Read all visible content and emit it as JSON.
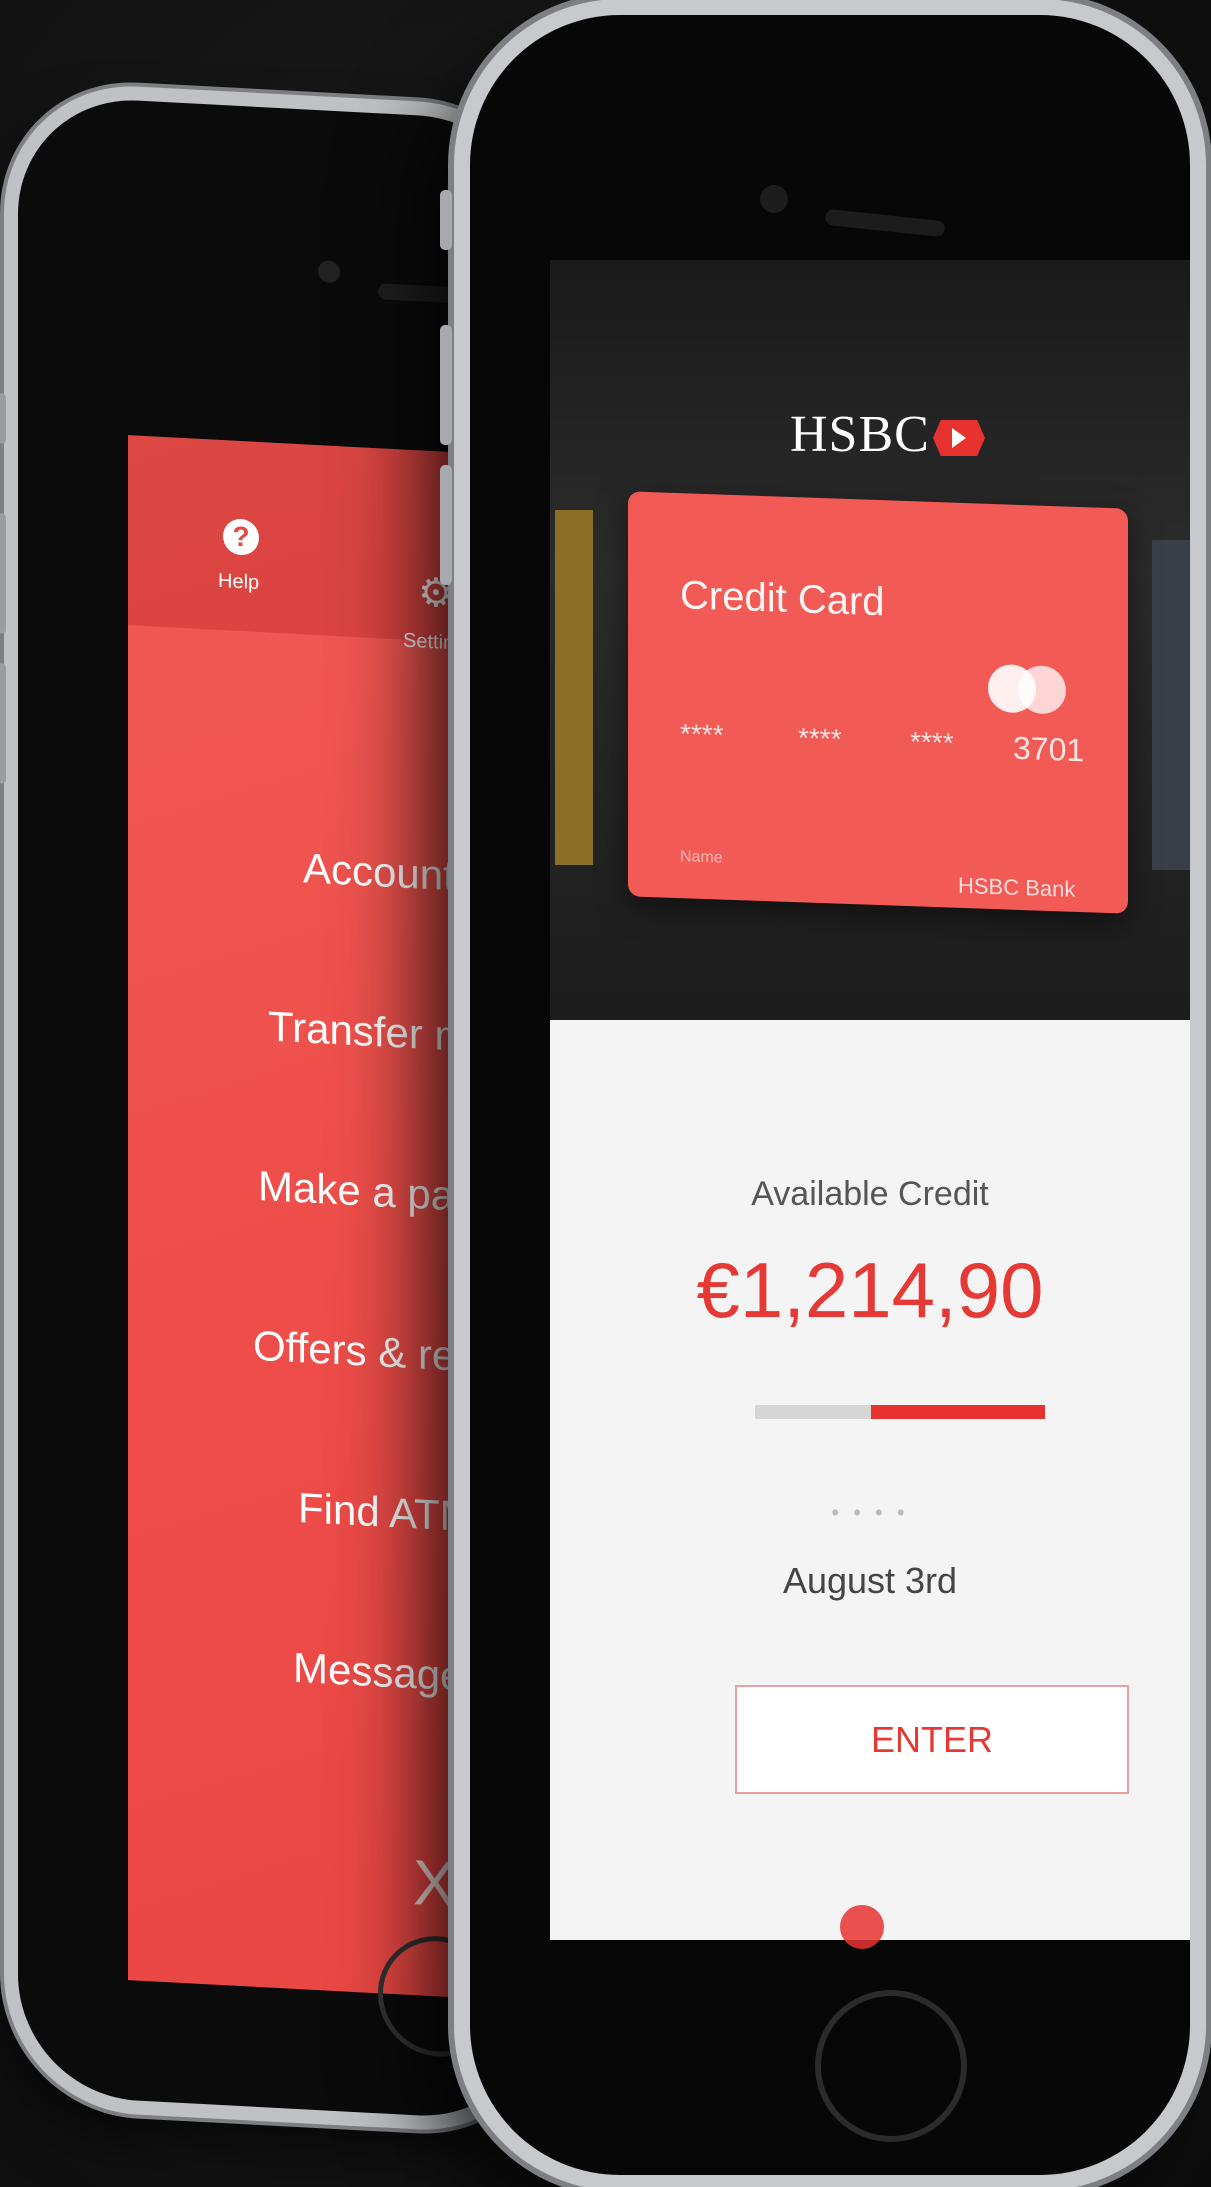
{
  "menu": {
    "help_label": "Help",
    "settings_label": "Settings",
    "items": [
      {
        "label": "Accounts"
      },
      {
        "label": "Transfer money"
      },
      {
        "label": "Make a payment"
      },
      {
        "label": "Offers & rewards"
      },
      {
        "label": "Find ATM"
      },
      {
        "label": "Messages"
      }
    ],
    "close_glyph": "X"
  },
  "brand": {
    "name": "HSBC"
  },
  "card": {
    "title": "Credit Card",
    "number_groups": [
      "****",
      "****",
      "****",
      "3701"
    ],
    "holder_label": "Name",
    "bank_label": "HSBC Bank"
  },
  "credit": {
    "label": "Available Credit",
    "amount": "€1,214,90",
    "used_fraction": 0.6,
    "date": "August 3rd",
    "dots": "• • • •"
  },
  "actions": {
    "enter_label": "ENTER"
  },
  "colors": {
    "accent": "#e8322f",
    "menu_bg": "#f15a55"
  }
}
